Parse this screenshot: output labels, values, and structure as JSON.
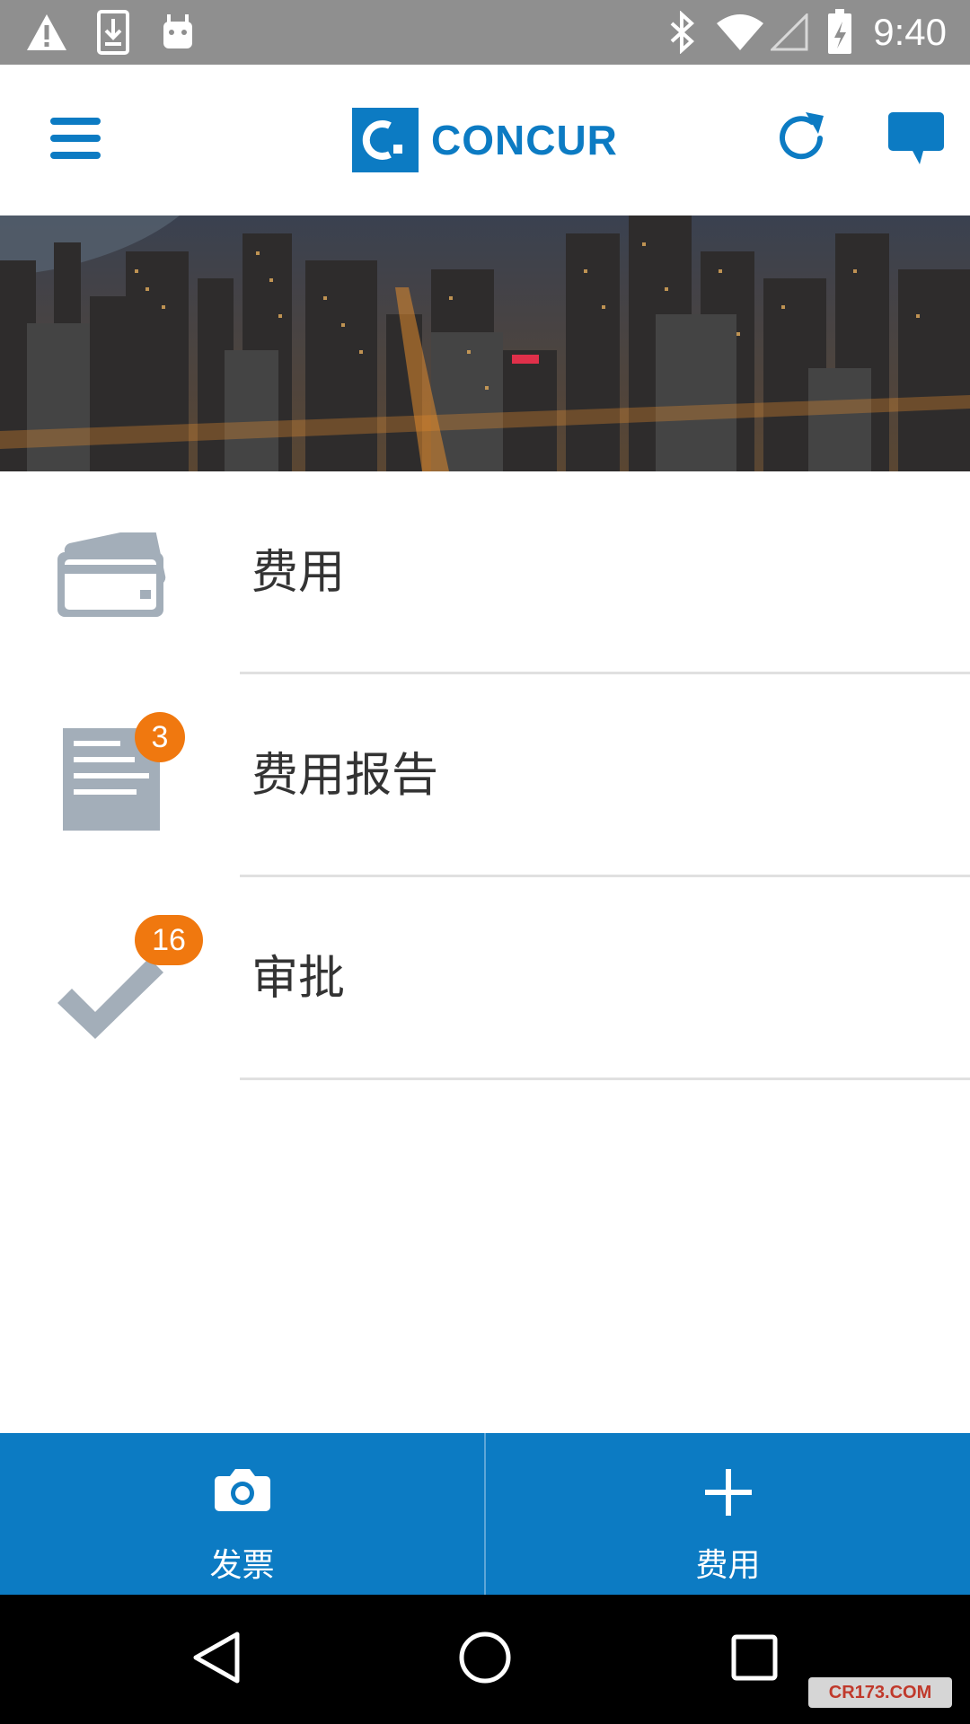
{
  "status_bar": {
    "time": "9:40",
    "left_icons": [
      "warning-icon",
      "download-icon",
      "android-icon"
    ],
    "right_icons": [
      "bluetooth-icon",
      "wifi-icon",
      "cell-signal-icon",
      "battery-icon"
    ]
  },
  "app_bar": {
    "logo_text": "CONCUR",
    "brand_color": "#0c7bc3"
  },
  "menu": {
    "items": [
      {
        "label": "费用",
        "icon": "credit-card-icon",
        "badge": ""
      },
      {
        "label": "费用报告",
        "icon": "report-document-icon",
        "badge": "3"
      },
      {
        "label": "审批",
        "icon": "checkmark-icon",
        "badge": "16"
      }
    ]
  },
  "actions": {
    "receipt_label": "发票",
    "expense_label": "费用"
  },
  "colors": {
    "accent": "#0c7bc3",
    "badge": "#f0780f",
    "icon_gray": "#a3aeb9"
  }
}
